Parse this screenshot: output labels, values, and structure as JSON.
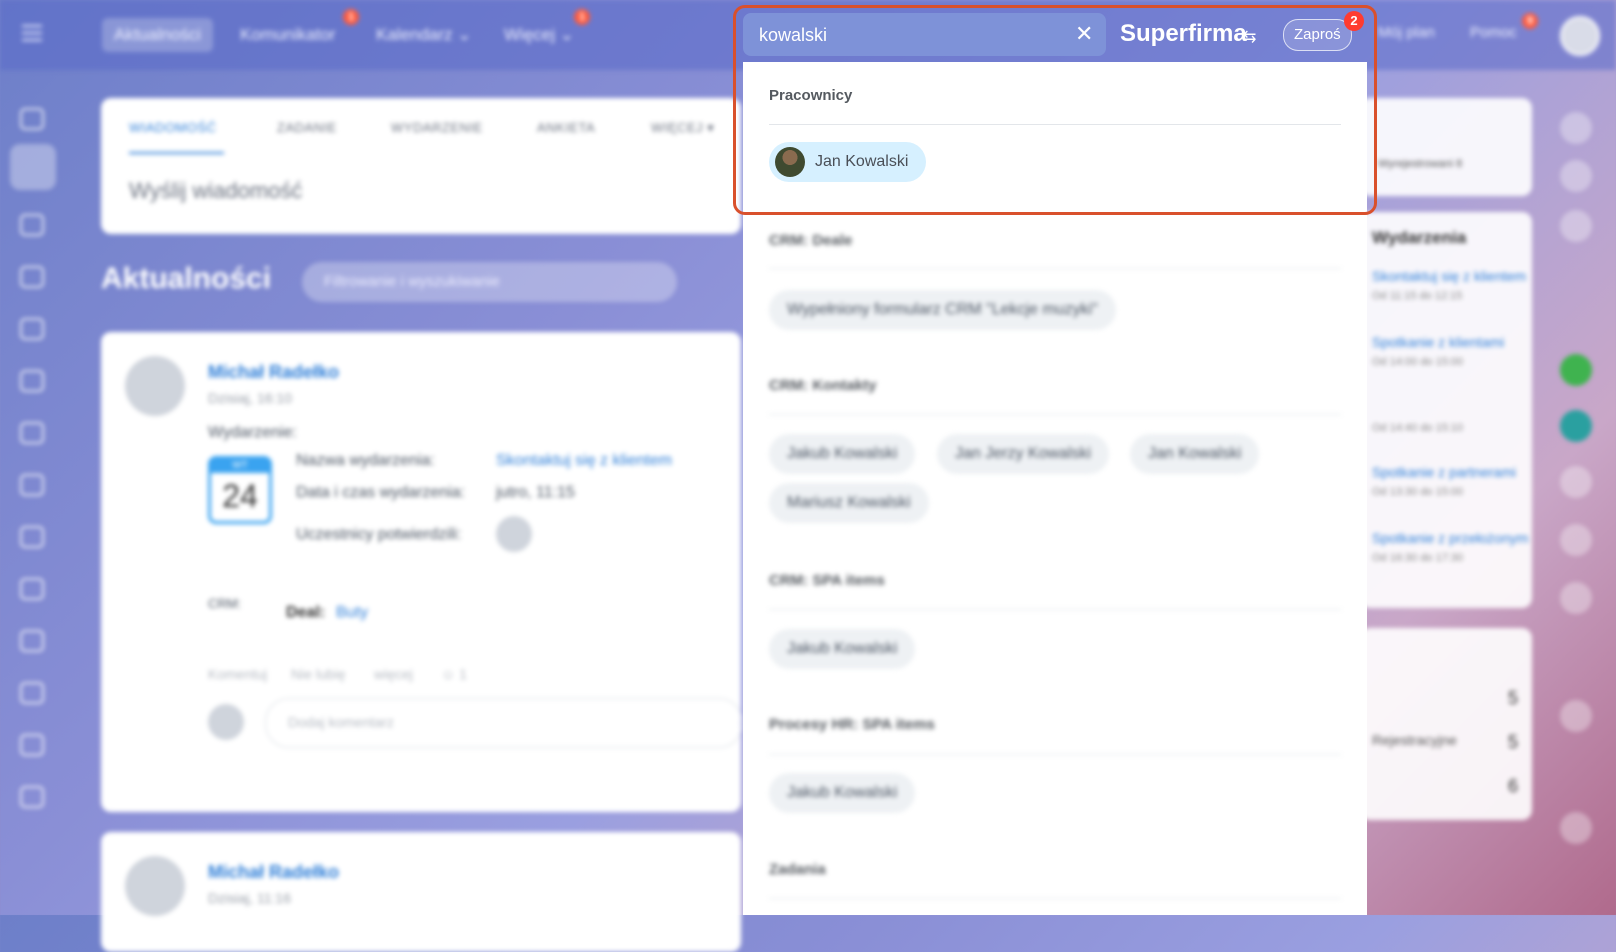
{
  "topnav": {
    "tabs": [
      {
        "label": "Aktualności",
        "badge": ""
      },
      {
        "label": "Komunikator",
        "badge": "1"
      },
      {
        "label": "Kalendarz ⌄",
        "badge": ""
      },
      {
        "label": "Więcej ⌄",
        "badge": "1"
      }
    ],
    "right": {
      "plan": "Mój plan",
      "help": "Pomoc",
      "help_badge": "9"
    }
  },
  "search": {
    "value": "kowalski",
    "brand": "Superfirma",
    "invite_label": "Zaproś",
    "invite_badge": "2",
    "sections": [
      {
        "title": "Pracownicy",
        "items": [
          "Jan Kowalski"
        ]
      },
      {
        "title": "CRM: Deale",
        "items": [
          "Wypełniony formularz CRM \"Lekcje muzyki\""
        ]
      },
      {
        "title": "CRM: Kontakty",
        "items": [
          "Jakub Kowalski",
          "Jan Jerzy Kowalski",
          "Jan Kowalski",
          "Mariusz Kowalski"
        ]
      },
      {
        "title": "CRM: SPA items",
        "items": [
          "Jakub Kowalski"
        ]
      },
      {
        "title": "Procesy HR: SPA items",
        "items": [
          "Jakub Kowalski"
        ]
      },
      {
        "title": "Zadania",
        "items": []
      }
    ]
  },
  "composer": {
    "tabs": [
      "WIADOMOŚĆ",
      "ZADANIE",
      "WYDARZENIE",
      "ANKIETA",
      "WIĘCEJ ▾"
    ],
    "placeholder": "Wyślij wiadomość"
  },
  "feed": {
    "title": "Aktualności",
    "filter_placeholder": "Filtrowanie i wyszukiwanie",
    "posts": [
      {
        "author": "Michał Radełko",
        "date": "Dzisiaj, 16:10",
        "type": "Wydarzenie:",
        "cal_weekday": "WT",
        "cal_day": "24",
        "event_name_label": "Nazwa wydarzenia:",
        "event_name": "Skontaktuj się z klientem",
        "event_time_label": "Data i czas wydarzenia:",
        "event_time": "jutro, 11:15",
        "participants_label": "Uczestnicy potwierdzili:",
        "crm_label": "CRM:",
        "deal_label": "Deal:",
        "deal_value": "Buty",
        "actions": [
          "Komentuj",
          "Nie lubię",
          "więcej",
          "☺ 1"
        ],
        "comment_placeholder": "Dodaj komentarz"
      },
      {
        "author": "Michał Radełko",
        "date": "Dzisiaj, 11:16"
      }
    ]
  },
  "right": {
    "events_title": "Wydarzenia",
    "registered": "Wyrejestrowani 8",
    "events": [
      "Skontaktuj się z klientem",
      "Spotkanie z klientami",
      "Spotkanie z partnerami",
      "Spotkanie z przełożonym"
    ],
    "event_times": [
      "Od 11:15 do 12:15",
      "Od 14:00 do 15:00",
      "Od 14:40 do 15:10",
      "Od 13:30 do 15:00",
      "Od 16:30 do 17:30"
    ],
    "stats": [
      "5",
      "5",
      "6"
    ],
    "stats_label": "Rejestracyjne"
  },
  "colors": {
    "accent": "#2f7fd8",
    "highlight": "#d9502c",
    "badge": "#ff3b30"
  }
}
